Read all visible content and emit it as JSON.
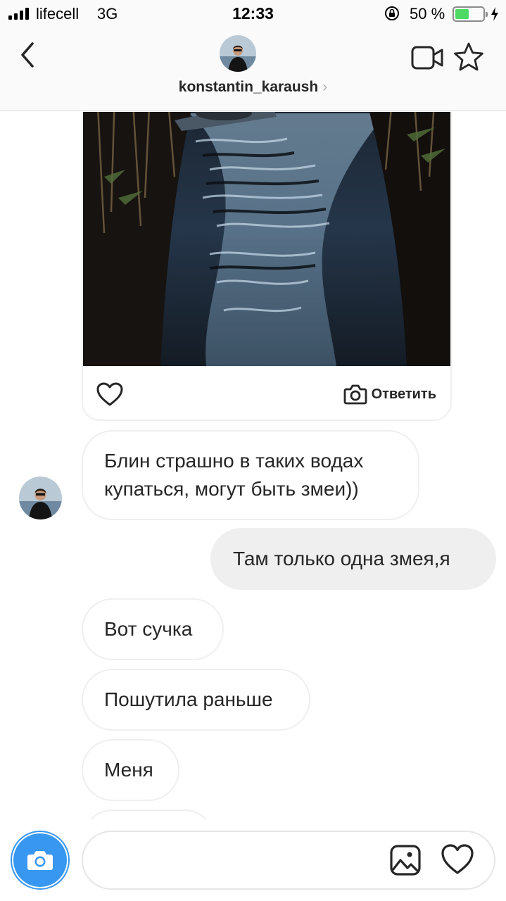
{
  "status_bar": {
    "carrier": "lifecell",
    "network": "3G",
    "time": "12:33",
    "battery_percent": "50 %",
    "battery_level": 0.5
  },
  "header": {
    "username": "konstantin_karaush",
    "chevron": "›",
    "icons": {
      "back": "chevron-left-icon",
      "video": "video-camera-icon",
      "star": "star-icon"
    }
  },
  "post": {
    "reply_label": "Ответить",
    "icons": {
      "like": "heart-icon",
      "reply": "camera-icon"
    }
  },
  "messages": [
    {
      "direction": "incoming",
      "text_lines": [
        "Блин страшно в таких водах",
        "купаться, могут быть змеи))"
      ]
    },
    {
      "direction": "outgoing",
      "text": "Там только одна змея,я"
    },
    {
      "direction": "incoming",
      "text": "Вот сучка"
    },
    {
      "direction": "incoming",
      "text": "Пошутила раньше"
    },
    {
      "direction": "incoming",
      "text": "Меня"
    }
  ],
  "composer": {
    "placeholder": "",
    "icons": {
      "camera": "camera-icon",
      "gallery": "image-icon",
      "like": "heart-icon"
    }
  },
  "colors": {
    "accent_blue": "#3897f0",
    "outgoing_bubble": "#efefef",
    "bubble_border": "#efefef",
    "battery_green": "#4cd964"
  }
}
